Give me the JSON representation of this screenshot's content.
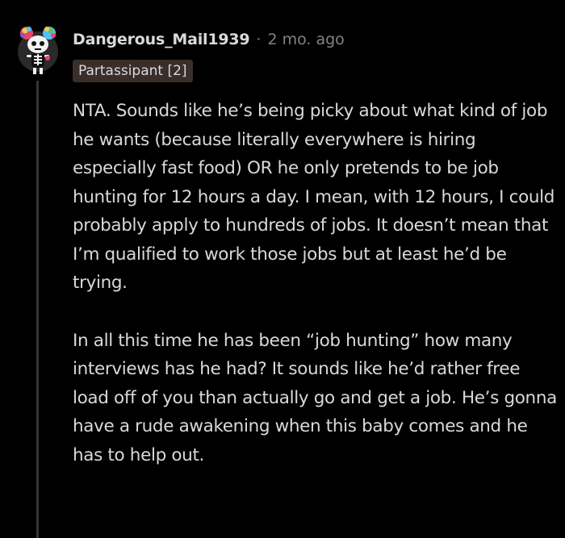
{
  "comment": {
    "author": "Dangerous_Mail1939",
    "separator": "·",
    "timestamp": "2 mo. ago",
    "flair": "Partassipant [2]",
    "paragraphs": [
      "NTA. Sounds like he’s being picky about what kind of job he wants (because literally everywhere is hiring especially fast food) OR he only pretends to be job hunting for 12 hours a day. I mean, with 12 hours, I could probably apply to hundreds of jobs. It doesn’t mean that I’m qualified to work those jobs but at least he’d be trying.",
      "In all this time he has been “job hunting” how many interviews has he had? It sounds like he’d rather free load off of you than actually go and get a job. He’s gonna have a rude awakening when this baby comes and he has to help out."
    ]
  },
  "colors": {
    "background": "#000000",
    "text": "#d7dadc",
    "meta": "#818384",
    "flair_bg": "#3a2e29",
    "thread_line": "#343536"
  },
  "icons": {
    "avatar": "snoo-avatar-skeleton-icon"
  }
}
